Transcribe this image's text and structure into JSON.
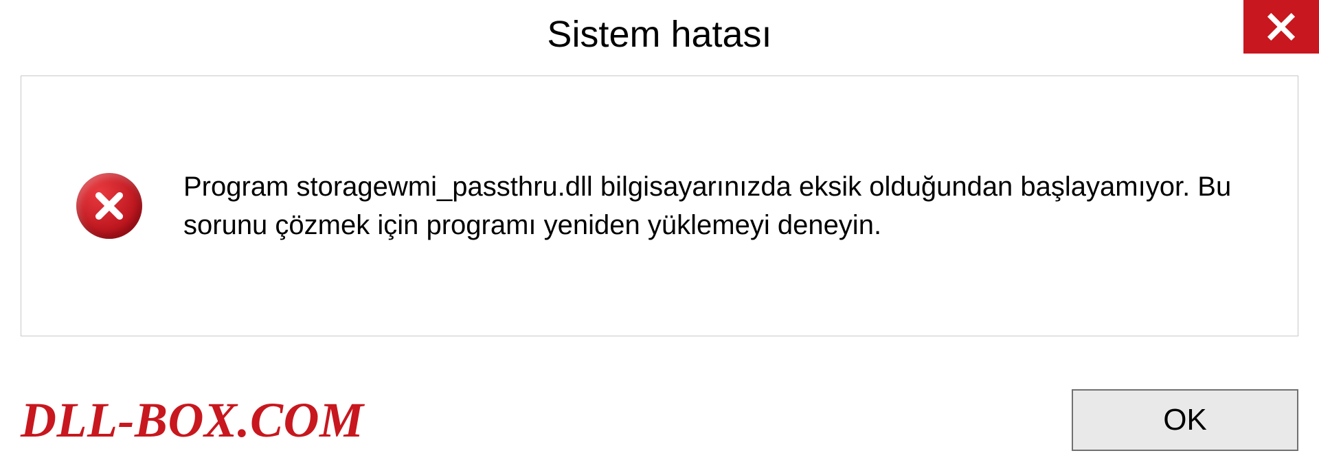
{
  "dialog": {
    "title": "Sistem hatası",
    "message": "Program storagewmi_passthru.dll bilgisayarınızda eksik olduğundan başlayamıyor. Bu sorunu çözmek için programı yeniden yüklemeyi deneyin.",
    "ok_label": "OK"
  },
  "watermark": "DLL-BOX.COM",
  "colors": {
    "accent_red": "#c8171e",
    "panel_border": "#c8c8c8",
    "button_bg": "#e9e9e9",
    "button_border": "#707070"
  }
}
